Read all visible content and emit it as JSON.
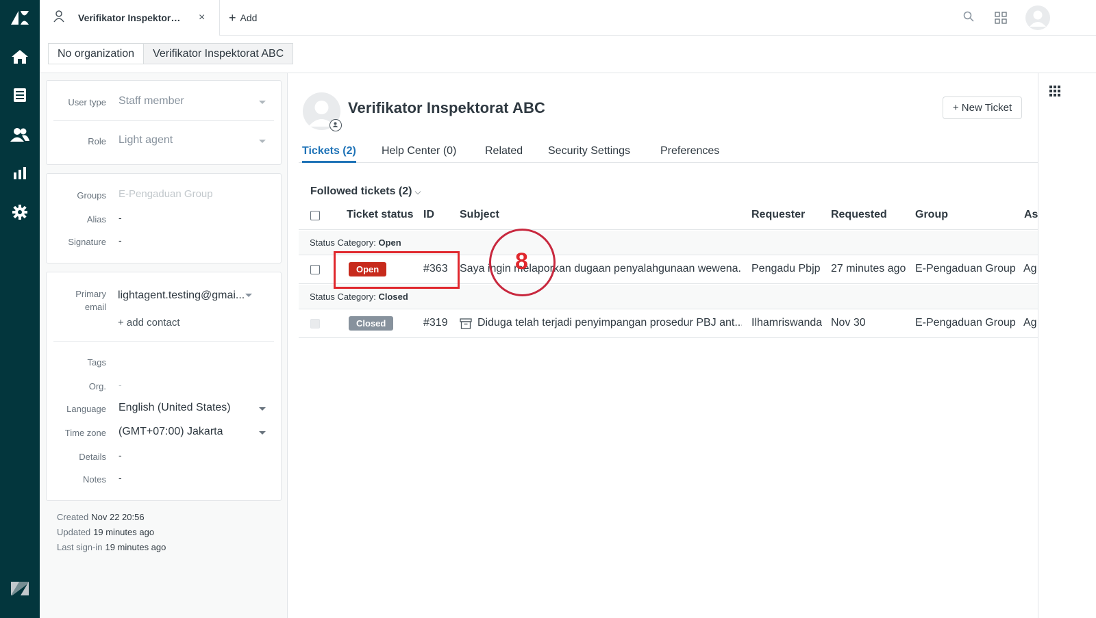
{
  "nav": {
    "items": [
      "logo-icon",
      "home-icon",
      "views-icon",
      "customers-icon",
      "reporting-icon",
      "admin-icon"
    ],
    "bottom": "zendesk-icon"
  },
  "topbar": {
    "tab_title": "Verifikator Inspektorat ABC",
    "close_glyph": "×",
    "add_label": "Add",
    "add_glyph": "+"
  },
  "breadcrumb": {
    "items": [
      "No organization",
      "Verifikator Inspektorat ABC"
    ]
  },
  "properties": {
    "user_type": {
      "label": "User type",
      "value": "Staff member"
    },
    "role": {
      "label": "Role",
      "value": "Light agent"
    },
    "groups": {
      "label": "Groups",
      "value": "E-Pengaduan Group"
    },
    "alias": {
      "label": "Alias",
      "value": "-"
    },
    "signature": {
      "label": "Signature",
      "value": "-"
    },
    "primary_email": {
      "label_1": "Primary",
      "label_2": "email",
      "value": "lightagent.testing@gmai..."
    },
    "add_contact": "+ add contact",
    "tags": {
      "label": "Tags",
      "value": ""
    },
    "org": {
      "label": "Org.",
      "value": "-"
    },
    "language": {
      "label": "Language",
      "value": "English (United States)"
    },
    "time_zone": {
      "label": "Time zone",
      "value": "(GMT+07:00) Jakarta"
    },
    "details": {
      "label": "Details",
      "value": "-"
    },
    "notes": {
      "label": "Notes",
      "value": "-"
    }
  },
  "meta": {
    "created": {
      "label": "Created",
      "value": "Nov 22 20:56"
    },
    "updated": {
      "label": "Updated",
      "value": "19 minutes ago"
    },
    "last_signin": {
      "label": "Last sign-in",
      "value": "19 minutes ago"
    }
  },
  "user": {
    "name": "Verifikator Inspektorat ABC",
    "new_ticket_label": "+ New Ticket"
  },
  "tabs": [
    "Tickets (2)",
    "Help Center (0)",
    "Related",
    "Security Settings",
    "Preferences"
  ],
  "followed": {
    "label": "Followed tickets (2)",
    "chevron": "⌵"
  },
  "table": {
    "headers": [
      "Ticket status",
      "ID",
      "Subject",
      "Requester",
      "Requested",
      "Group",
      "As"
    ],
    "groups": [
      {
        "category_prefix": "Status Category:",
        "category": "Open",
        "row": {
          "status": "Open",
          "id": "#363",
          "subject": "Saya ingin melaporkan dugaan penyalahgunaan wewena...",
          "requester": "Pengadu Pbjp",
          "requested": "27 minutes ago",
          "group": "E-Pengaduan Group",
          "assignee": "Ag"
        }
      },
      {
        "category_prefix": "Status Category:",
        "category": "Closed",
        "row": {
          "status": "Closed",
          "id": "#319",
          "subject": "Diduga telah terjadi penyimpangan prosedur PBJ ant...",
          "requester": "Ilhamriswanda",
          "requested": "Nov 30",
          "group": "E-Pengaduan Group",
          "assignee": "Ag"
        }
      }
    ]
  },
  "annotation": {
    "step_number": "8"
  },
  "colors": {
    "rail": "#03363d",
    "accent": "#1f73b7",
    "open": "#c72a1c",
    "closed": "#87929d",
    "annotation": "#e0282e"
  }
}
